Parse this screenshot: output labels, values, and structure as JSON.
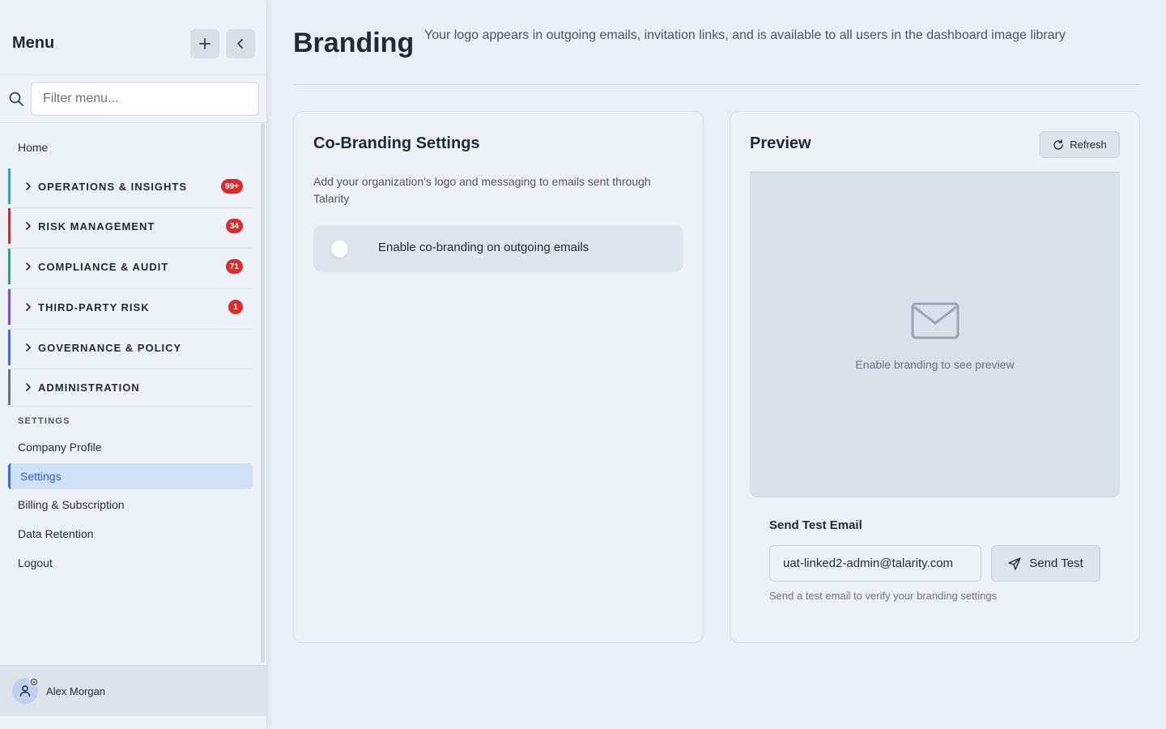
{
  "sidebar": {
    "title": "Menu",
    "add_icon": "plus-icon",
    "collapse_icon": "chevron-left-icon",
    "search": {
      "placeholder": "Filter menu...",
      "value": ""
    },
    "home_label": "Home",
    "groups": [
      {
        "label": "OPERATIONS & INSIGHTS",
        "badge": "99+",
        "accent": "#2f9bd6"
      },
      {
        "label": "RISK MANAGEMENT",
        "badge": "34",
        "accent": "#c53030"
      },
      {
        "label": "COMPLIANCE & AUDIT",
        "badge": "71",
        "accent": "#2f9e7b"
      },
      {
        "label": "THIRD-PARTY RISK",
        "badge": "1",
        "accent": "#7c4dcc"
      },
      {
        "label": "GOVERNANCE & POLICY",
        "badge": "",
        "accent": "#3b6fd8"
      },
      {
        "label": "ADMINISTRATION",
        "badge": "",
        "accent": "#6b7280"
      }
    ],
    "settings_section": {
      "header": "SETTINGS",
      "items": [
        {
          "label": "Company Profile"
        },
        {
          "label": "Settings",
          "active": true
        },
        {
          "label": "Billing & Subscription"
        },
        {
          "label": "Data Retention"
        },
        {
          "label": "Logout"
        }
      ]
    },
    "user": {
      "name": "Alex Morgan"
    }
  },
  "main": {
    "title": "Branding",
    "subtitle": "Your logo appears in outgoing emails, invitation links, and is available to all users in the dashboard image library",
    "cobranding": {
      "title": "Co-Branding Settings",
      "description": "Add your organization's logo and messaging to emails sent through Talarity",
      "toggle_label": "Enable co-branding on outgoing emails",
      "toggle_on": false
    },
    "preview": {
      "title": "Preview",
      "refresh_label": "Refresh",
      "empty_text": "Enable branding to see preview",
      "send_test": {
        "title": "Send Test Email",
        "email_value": "uat-linked2-admin@talarity.com",
        "button_label": "Send Test",
        "hint": "Send a test email to verify your branding settings"
      }
    }
  },
  "colors": {
    "badge": "#d92d2d",
    "active_bg": "#cfe0f7",
    "active_text": "#2f5fbf"
  }
}
